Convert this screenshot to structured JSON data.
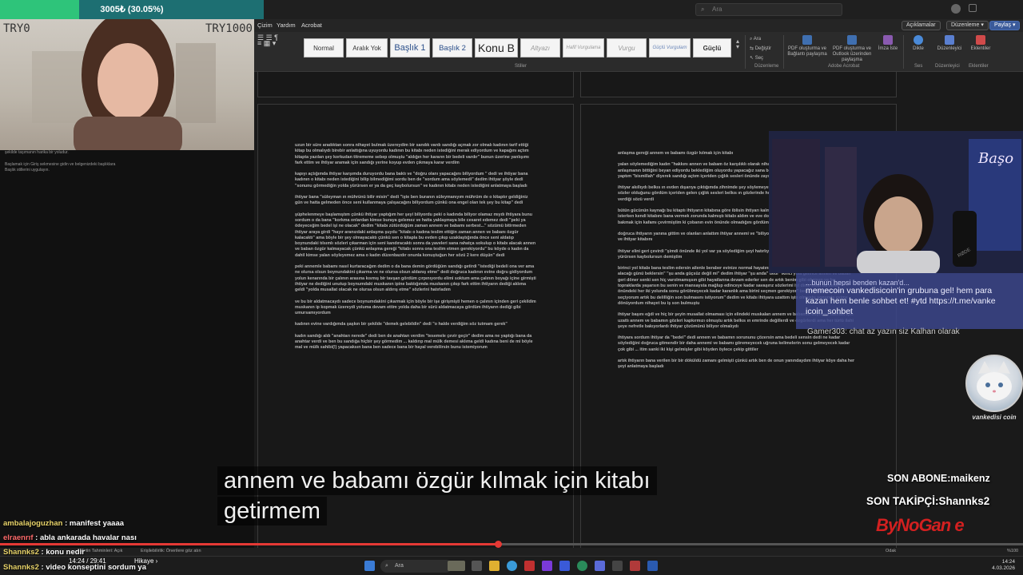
{
  "donation": {
    "text": "3005₺ (30.05%)",
    "progress": 0.3005
  },
  "cam1": {
    "left_label": "TRY0",
    "right_label": "TRY1000"
  },
  "word": {
    "search_placeholder": "Ara",
    "menu": [
      "Çizim",
      "Yardım",
      "Acrobat"
    ],
    "right_buttons": {
      "comments": "Açıklamalar",
      "editing": "Düzenleme ▾",
      "share": "Paylaş ▾"
    },
    "styles": [
      "Normal",
      "Aralık Yok",
      "Başlık 1",
      "Başlık 2",
      "Konu B",
      "Altyazı",
      "Hafif Vurgulama",
      "Vurgu",
      "Güçlü Vurgulam",
      "Güçlü"
    ],
    "groups": {
      "styles": "Stiller",
      "editing": "Düzenleme",
      "adobe": "Adobe Acrobat",
      "voice": "Ses",
      "editor": "Düzenleyici",
      "addins": "Eklentiler"
    },
    "tools": {
      "find": "Ara",
      "replace": "Değiştir",
      "select": "Seç",
      "pdf_share": "PDF oluşturma ve Bağlantı paylaşma",
      "pdf_outlook": "PDF oluşturma ve Outlook üzerinden paylaşma",
      "request_sign": "İmza İste",
      "dictate": "Dikte",
      "editor": "Düzenleyici",
      "addins": "Eklentiler"
    },
    "sidebar_note_1": "şekilde taşımanın harika bir yoludur.",
    "sidebar_note_2": "Başlamak için Giriş sekmesine gidin ve belgenizdeki başlıklara Başlık stillerini uygulayın.",
    "page1_paragraphs": [
      "uzun bir süre aradıktan sonra nihayet bulmak üzereydim bir sandık vardı sandığı açmak zor olmalı kadının tarif ettiği kitap bu olmalıydı birebir anlattığına uyuyordu kadının bu kitabı neden istediğini merak ediyordum ve kapağını açtım kitapta yazılan şey korkudan titrememe sebep olmuştu \"aldığın her kararın bir bedeli vardır\" bunun üzerine yanlışımı fark ettim ve ihtiyar aramak için sandığı yerine koyup evden çıkmaya karar verdim",
      "kapıyı açtığımda ihtiyar karşımda duruyordu bana baktı ve \"doğru olanı yapacağını biliyordum \" dedi ve ihtiyar bana kadının o kitabı neden istediğini bilip bilmediğimi sordu ben de \"sordum ama söylemedi\" dedim ihtiyar şöyle dedi \"sonunu görmediğin yolda yürürsen er ya da geç kaybolursun\" ve kadının kitabı neden istediğini anlatmaya başladı",
      "ihtiyar bana \"süleyman ın mührünü bilir misin\" dedi \"işte ben buranın süleymanıyım mührüm de o kitaptır geldiğiniz gün ve hatta gelmeden önce seni kullanmaya çalışacağını biliyordum çünkü ona engel olan tek şey bu kitap\" dedi",
      "şüphelenmeye başlamıştım çünkü ihtiyar yaptığım her şeyi biliyordu peki o kadında biliyor olamaz mıydı ihtiyara bunu sordum o da bana \"korkma onlardan kimse buraya gelemez ve hatta yaklaşmaya bile cesaret edemez dedi \"peki ya ödeyeceğim bedel işi ne olacak\" dedim \"kitabı zütürdüğüm zaman annem ve babamı serbest...\" sözümü bitirmeden ihtiyar araya girdi \"hayır aranızdaki anlaşma şuydu \"kitabı o kadına teslim ettiğin zaman annen ve babanı özgür kalacaktı\" ama böyle bir şey olmayacaktı çünkü sen o kitapla bu evden çıkıp uzaklaştığında önce seni aldatıp boynundaki tılsımlı sözleri çıkarman için seni kandıracaktı sonra da yaveleri sana rahatça sokulup o kitabı alacak annen ve baban özgür kalmayacak çünkü anlaşma gereği \"kitabı sonra ona teslim etmen gerekiyordu\" bu köyde o kadın da dahil kimse yalan söyleyemez ama o kadın düzenbazdır onunla konuştuğun her sözü 2 kere düşün\" dedi",
      "peki annemle babamı nasıl kurtaracağım dedim o da bana demin gördüğüm sandığı getirdi \"istediği bedeli ona ver ama ne olursa olsun boynundakini çıkarma ve ne olursa olsun aldanış etme\" dedi doğruca kadının evine doğru gidiyordum yolun kenarında bir çalının arasına kısmış bir tavşan gördüm çırpınıyordu elimi soktum ama çalının boyağı içine girmişti ihtiyar ne dediğini unutup boynumdaki muskanın ipine baktığımda muskanın çıkıp fark ettim ihtiyarın dediği aklıma geldi \"yolda musallat olacak ne olursa olsun aldırış etme\" sözlerini hatırladım",
      "ve bu bir aldatmacaydı sadece boynumdakini çıkarmak için böyle bir işe girişmişti hemen o çalının içinden geri çekildim muskanın ip kopmak üzereydi yoluma devam ettim yolda daha bir sürü aldatmacaya gördüm ihtiyarın dediği gibi umursamıyordum",
      "kadının evine vardığımda şaşkın bir şekilde \"demek gelebildin\" dedi \"o halde verdiğim söz tutmam gerek\"",
      "kadın sandığı aldı \"anahtarı nerede\" dedi ben de anahtarı verdim \"tesemele çevir geçir\" dedim ama ne yaptığı bana da anahtar verdi ve ben bu sandığa hiçbir şey görmedim ... kaldırıp mal mülk demesi aklıma geldi kadına beni de mi böyle mal ve mülk sahibi(!) yapacaksın bana ben sadece bana bir hayal verebilirsin bunu istemiyorum"
    ],
    "page2_paragraphs": [
      "anlaşma gereği annem ve babamı özgür kılmak için kitabı",
      "yalan söylemediğim kadın \"hakkını annen ve babam öz karşılıklı olarak nihayete erdirmek istiyorum\" dedi ben de anlaşmanın bittiğini beyan ediyordu beklediğim oluyordu yapacağız sana bende olan iblisin kitabını verirsen sadece yaptım \"bismillah\" diyerek sandığı açtım içeriden çığlık sesleri önünde zayıflamaya kamburlaşmaya gözüzleşmeye baş",
      "ihtiyar akıllıydı belkıs ın evden dışarıya çıktığımda zihnimde şey söylemeyen sandığa sandığın içine baktığımda tılsımlı sözler olduğunu gördüm içeriden gelen çığlık sesleri belkıs ın gözlerinde hoşuma gitmişti intikamımı alıyordum belkıs verdiği sözü verdi",
      "bütün gücünün kaynağı bu kitaptı ihtiyarın kitabına göre iblisin ihtiyarı kalmayacaktı ama ihtiyarın kitabını almak isterken kendi kitabını bana vermek zorunda kalmıştı kitabı aldım ve eve doğru yola koyuldum son bir defa o lanetli eve bakmak için kafamı çevirmiştim ki çobanın evin önünde olmadığını gördüm ... evi böyle savunmasız gördüm",
      "doğruca ihtiyarın yanına gittim ve olanları anlattım ihtiyar annemi ve \"biliyorum evlat\"dedi annem ve babama sarıldım ve ihtiyar kitabını",
      "ihtiyar elini geri çevirdi \"şimdi önünde iki yol var ya söylediğim şeyi hatırlıyor musun sonunu görmediğin yolda yürürsen kaybolursun demiştim",
      "birinci yol kitabı bana teslim edersin ailenle beraber evinize normal hayatınız geri dönersiniz ve belkıs ın sizden intikam alacağı günü beklersin\" \"şu anda güçsüz değil mi\" dedim ihtiyar \"şu anda\" dedi \"ikinci yola gelince annen ve baban geri döner senki sen hiç varolmamışsın gibi hayatlarına devam ederler sen de artık benim gibi olursun ve bu topraklarda yaşarsın bu senin ve mansaysta mağlup edinceye kadar savaşırız sözlerimi iyi dinle evlat bu sefer önündeki her iki yolunda sonu görülmeyecek kadar karanlık ama birini seçmen gerekiyor\" ben \"bunlardan ikinci seçiyorum artık bu delilliğin son bulmasını istiyorum\" dedim ve kitabı ihtiyara uzattım işte olmuştu sonunda evime dönüyordum nihayet bu iş son bulmuştu",
      "ihtiyar başını eğdi ve hiç bir şeyin musallat olmaması için elindeki muskaları annem ve babamın boynuna takmak için uzattı annem ve babamın gözleri kapkırmızı olmuştu artık belkıs ın emrinde değillerdi ve özgürlerdi ama her türlü ilahi şeye nefretle bakıyorlardı ihtiyar çözümünü biliyor olmalıydı",
      "ihtiyara sordum ihtiyar da \"bedel\" dedi annem ve babamın sorununu çözersin ama bedeli sensin dedi ne kadar söylediğini doğruca gitmendir bir daha annemi ve babamı göremeyecek uğruna kelimelerin sonu gelmeyecek kadar çok gibi ... itim sanki iki kişi gelmişler gibi köyden öylece çekip gittiler",
      "artık ihtiyarın bana verilen bir bir döküldü zamanı gelmişti çünkü artık ben de onun yanındaydım ihtiyar köye daha her şeyi anlatmaya başladı"
    ]
  },
  "stream": {
    "chat_overlay_lines": [
      "...bunun hepsi benden kazan'd...",
      "memecoin vankedisicoin'in grubuna gel! hem para",
      "kazan hem benle sohbet et! #ytd https://t.me/vanke",
      "icoin_sohbet"
    ],
    "chat_overlay_next": "Gamer303: chat az yazın siz Kalhan olarak",
    "cam2_mic_label": "RØDE",
    "cam2_sign": "Başo",
    "cat_name": "vankedisi coin",
    "last_subscriber": "SON ABONE:maikenz",
    "last_follower": "SON TAKİPÇİ:Shannks2",
    "logo": "ByNoGan e",
    "subtitle_lines": [
      "annem ve babamı özgür kılmak için kitabı",
      "getirmem"
    ],
    "chat": [
      {
        "user": "ambalajoguzhan",
        "text": "manifest yaaaa",
        "color": "yellow"
      },
      {
        "user": "elraenrıf",
        "text": "abla ankarada havalar nası",
        "color": "red"
      },
      {
        "user": "Shannks2",
        "text": "konu nedir",
        "color": "yellow"
      },
      {
        "user": "Shannks2",
        "text": "video konseptini sordum ya",
        "color": "yellow"
      }
    ]
  },
  "player": {
    "time": "14:24 / 29:41",
    "chapter": "Hikaye",
    "progress": 0.487
  },
  "statusbar": {
    "left": "Metin Tahminleri: Açık",
    "accessibility": "Erişilebilirlik: Önerilere göz atın",
    "focus": "Odak",
    "zoom": "%100"
  },
  "taskbar": {
    "search": "Ara",
    "time": "14:24",
    "date": "4.03.2026"
  }
}
